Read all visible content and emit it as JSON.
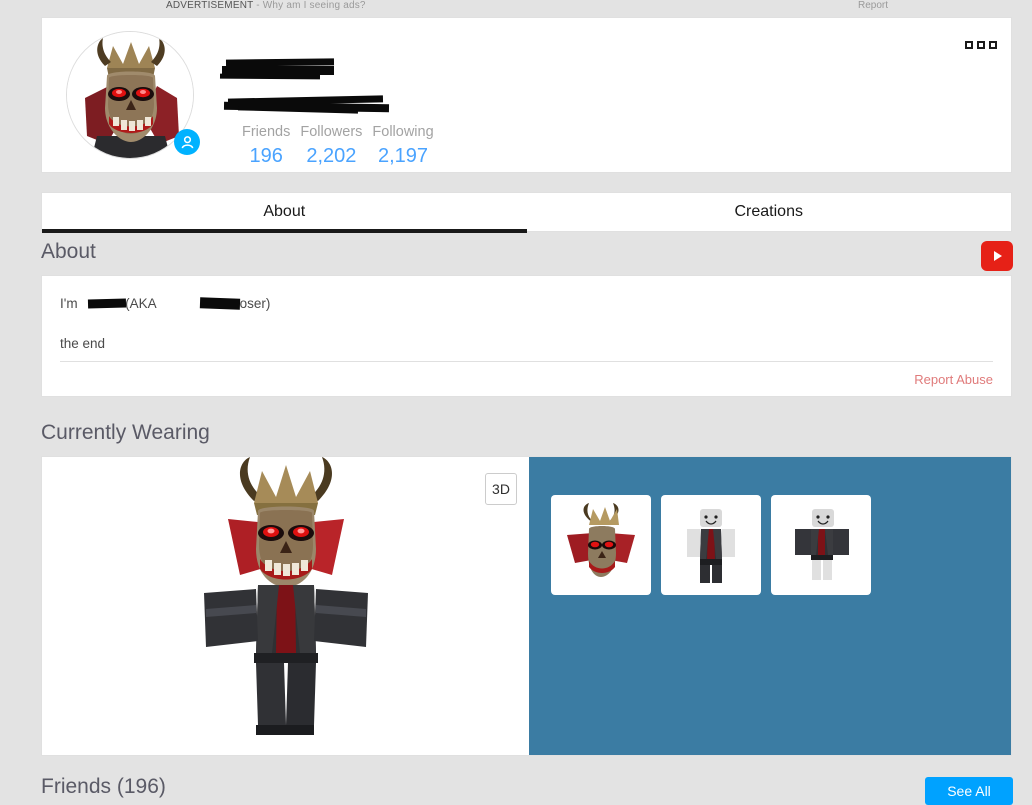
{
  "ad": {
    "label": "ADVERTISEMENT",
    "separator": " - ",
    "why_link": "Why am I seeing ads?",
    "report_link": "Report"
  },
  "profile": {
    "display_name_redacted": true,
    "username_redacted": true,
    "status_badge_icon": "person-icon",
    "overflow_menu_icon": "more-options-icon",
    "stats": [
      {
        "label": "Friends",
        "value": "196"
      },
      {
        "label": "Followers",
        "value": "2,202"
      },
      {
        "label": "Following",
        "value": "2,197"
      }
    ]
  },
  "tabs": [
    {
      "label": "About",
      "active": true
    },
    {
      "label": "Creations",
      "active": false
    }
  ],
  "about": {
    "heading": "About",
    "youtube_icon": "youtube-icon",
    "line1_prefix": "I'm ",
    "line1_mid": " (AKA ",
    "line1_suffix": " The Loser)",
    "line2": "the end",
    "report_abuse": "Report Abuse"
  },
  "currently_wearing": {
    "heading": "Currently Wearing",
    "view_3d_label": "3D",
    "avatar_render_alt": "avatar-full-body",
    "items": [
      {
        "name": "demon-skull-mask-thumbnail"
      },
      {
        "name": "black-jacket-outfit-thumbnail"
      },
      {
        "name": "black-torso-outfit-thumbnail"
      }
    ]
  },
  "friends": {
    "heading": "Friends (196)",
    "see_all_label": "See All"
  },
  "colors": {
    "page_background": "#e3e3e3",
    "card_background": "#ffffff",
    "accent_blue": "#00a2ff",
    "stat_value_blue": "#4aa3ff",
    "wearing_panel_blue": "#3b7ca3",
    "youtube_red": "#e62117",
    "report_abuse_red": "#e07b7b",
    "heading_gray": "#5a5a66"
  }
}
